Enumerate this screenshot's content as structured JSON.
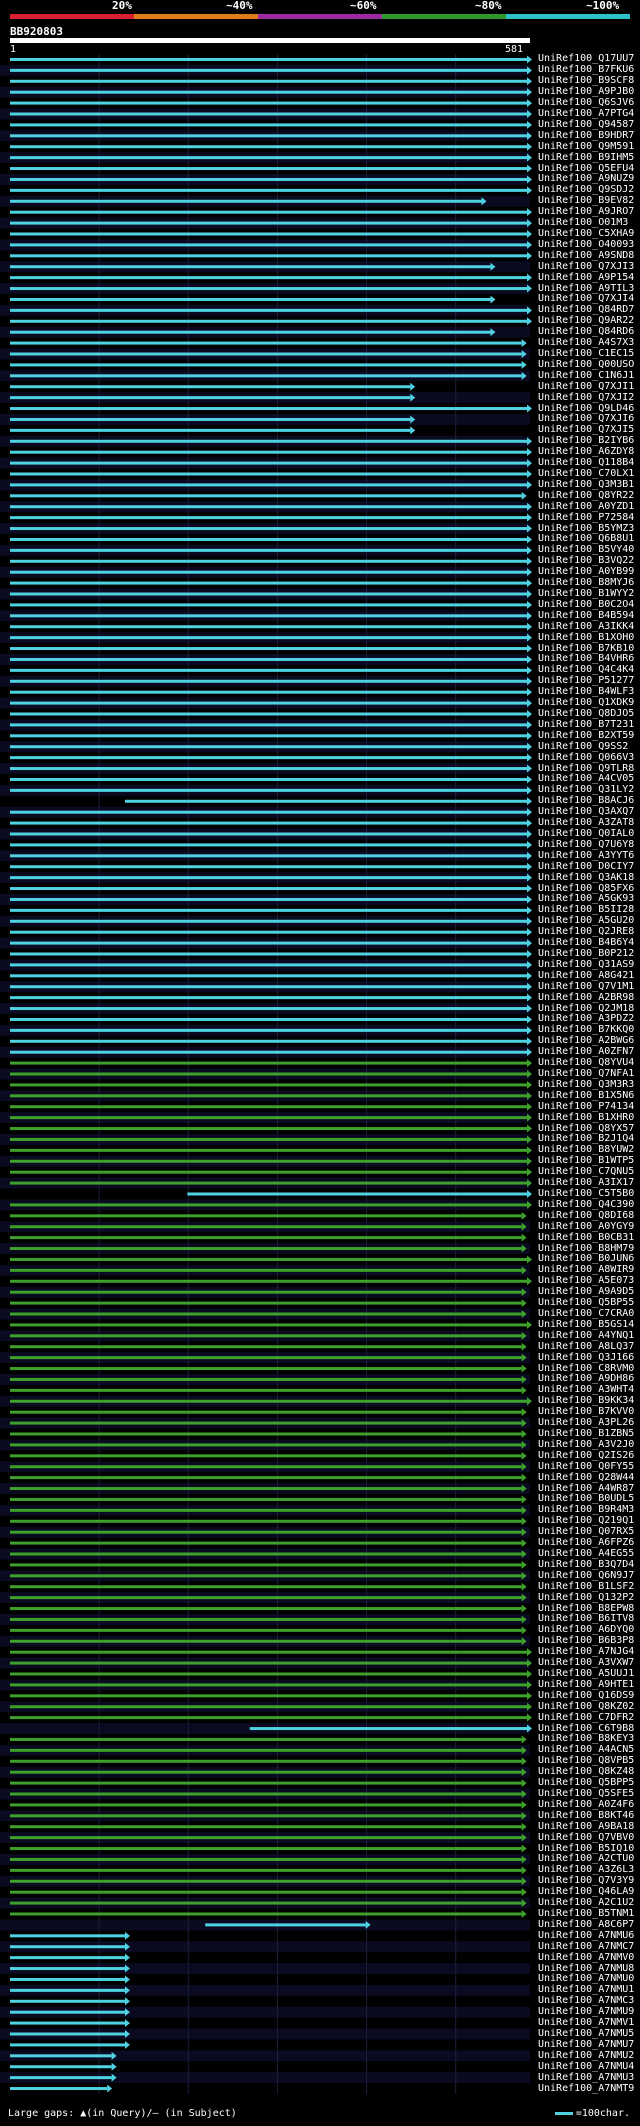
{
  "scale": {
    "labels": [
      "20%",
      "~40%",
      "~60%",
      "~80%",
      "~100%"
    ],
    "colors": [
      "#d8202e",
      "#e07b1a",
      "#9a2a9e",
      "#2e9a2e",
      "#2ec0c8"
    ]
  },
  "query": {
    "name": "BB920803",
    "start": "1",
    "end": "581"
  },
  "grid": {
    "stripe": "#0a0a20",
    "gridline": "#1e1e3a",
    "cyan": "#4fd3e3",
    "green": "#3ea12b"
  },
  "hits": [
    {
      "id": "UniRef100_Q17UU7",
      "start": 1,
      "end": 581,
      "pct": 100
    },
    {
      "id": "UniRef100_B7FKU6",
      "start": 1,
      "end": 581,
      "pct": 100
    },
    {
      "id": "UniRef100_B9SCF8",
      "start": 1,
      "end": 581,
      "pct": 100
    },
    {
      "id": "UniRef100_A9PJB0",
      "start": 1,
      "end": 581,
      "pct": 100
    },
    {
      "id": "UniRef100_Q6SJV6",
      "start": 1,
      "end": 581,
      "pct": 100
    },
    {
      "id": "UniRef100_A7PTG4",
      "start": 1,
      "end": 581,
      "pct": 100
    },
    {
      "id": "UniRef100_Q94587",
      "start": 1,
      "end": 581,
      "pct": 100
    },
    {
      "id": "UniRef100_B9HDR7",
      "start": 1,
      "end": 581,
      "pct": 100
    },
    {
      "id": "UniRef100_Q9M591",
      "start": 1,
      "end": 581,
      "pct": 100
    },
    {
      "id": "UniRef100_B9IHM5",
      "start": 1,
      "end": 581,
      "pct": 100
    },
    {
      "id": "UniRef100_Q5EFU4",
      "start": 1,
      "end": 581,
      "pct": 100
    },
    {
      "id": "UniRef100_A9NUZ9",
      "start": 1,
      "end": 581,
      "pct": 100
    },
    {
      "id": "UniRef100_Q9SDJ2",
      "start": 1,
      "end": 581,
      "pct": 100
    },
    {
      "id": "UniRef100_B9EV82",
      "start": 1,
      "end": 530,
      "pct": 100
    },
    {
      "id": "UniRef100_A9JRO7",
      "start": 1,
      "end": 581,
      "pct": 100
    },
    {
      "id": "UniRef100_O01M3",
      "start": 1,
      "end": 581,
      "pct": 100
    },
    {
      "id": "UniRef100_C5XHA9",
      "start": 1,
      "end": 581,
      "pct": 100
    },
    {
      "id": "UniRef100_O40093",
      "start": 1,
      "end": 581,
      "pct": 100
    },
    {
      "id": "UniRef100_A9SND8",
      "start": 1,
      "end": 581,
      "pct": 100
    },
    {
      "id": "UniRef100_Q7XJI3",
      "start": 1,
      "end": 540,
      "pct": 100
    },
    {
      "id": "UniRef100_A9P154",
      "start": 1,
      "end": 581,
      "pct": 100
    },
    {
      "id": "UniRef100_A9TIL3",
      "start": 1,
      "end": 581,
      "pct": 100
    },
    {
      "id": "UniRef100_Q7XJI4",
      "start": 1,
      "end": 540,
      "pct": 100
    },
    {
      "id": "UniRef100_Q84RD7",
      "start": 1,
      "end": 581,
      "pct": 100
    },
    {
      "id": "UniRef100_Q9AR22",
      "start": 1,
      "end": 581,
      "pct": 100
    },
    {
      "id": "UniRef100_Q84RD6",
      "start": 1,
      "end": 540,
      "pct": 100
    },
    {
      "id": "UniRef100_A4S7X3",
      "start": 1,
      "end": 575,
      "pct": 100
    },
    {
      "id": "UniRef100_C1EC15",
      "start": 1,
      "end": 575,
      "pct": 100
    },
    {
      "id": "UniRef100_Q00USO",
      "start": 1,
      "end": 575,
      "pct": 100
    },
    {
      "id": "UniRef100_C1N6J1",
      "start": 1,
      "end": 575,
      "pct": 100
    },
    {
      "id": "UniRef100_Q7XJI1",
      "start": 1,
      "end": 450,
      "pct": 100
    },
    {
      "id": "UniRef100_Q7XJI2",
      "start": 1,
      "end": 450,
      "pct": 100
    },
    {
      "id": "UniRef100_Q9LD46",
      "start": 1,
      "end": 581,
      "pct": 100
    },
    {
      "id": "UniRef100_Q7XJI6",
      "start": 1,
      "end": 450,
      "pct": 100
    },
    {
      "id": "UniRef100_Q7XJI5",
      "start": 1,
      "end": 450,
      "pct": 100
    },
    {
      "id": "UniRef100_B2IYB6",
      "start": 1,
      "end": 581,
      "pct": 100
    },
    {
      "id": "UniRef100_A6ZDY8",
      "start": 1,
      "end": 581,
      "pct": 100
    },
    {
      "id": "UniRef100_Q118B4",
      "start": 1,
      "end": 581,
      "pct": 100
    },
    {
      "id": "UniRef100_C70LX1",
      "start": 1,
      "end": 581,
      "pct": 100
    },
    {
      "id": "UniRef100_Q3M3B1",
      "start": 1,
      "end": 581,
      "pct": 100
    },
    {
      "id": "UniRef100_Q8YR22",
      "start": 1,
      "end": 575,
      "pct": 100
    },
    {
      "id": "UniRef100_A0YZD1",
      "start": 1,
      "end": 581,
      "pct": 100
    },
    {
      "id": "UniRef100_P72584",
      "start": 1,
      "end": 581,
      "pct": 100
    },
    {
      "id": "UniRef100_B5YMZ3",
      "start": 1,
      "end": 581,
      "pct": 100
    },
    {
      "id": "UniRef100_Q6B8U1",
      "start": 1,
      "end": 581,
      "pct": 100
    },
    {
      "id": "UniRef100_B5VY40",
      "start": 1,
      "end": 581,
      "pct": 100
    },
    {
      "id": "UniRef100_B3VQ22",
      "start": 1,
      "end": 581,
      "pct": 100
    },
    {
      "id": "UniRef100_A0YB99",
      "start": 1,
      "end": 581,
      "pct": 100
    },
    {
      "id": "UniRef100_B8MYJ6",
      "start": 1,
      "end": 581,
      "pct": 100
    },
    {
      "id": "UniRef100_B1WYY2",
      "start": 1,
      "end": 581,
      "pct": 100
    },
    {
      "id": "UniRef100_B0C2O4",
      "start": 1,
      "end": 581,
      "pct": 100
    },
    {
      "id": "UniRef100_B4B594",
      "start": 1,
      "end": 581,
      "pct": 100
    },
    {
      "id": "UniRef100_A3IKK4",
      "start": 1,
      "end": 581,
      "pct": 100
    },
    {
      "id": "UniRef100_B1XOH0",
      "start": 1,
      "end": 581,
      "pct": 100
    },
    {
      "id": "UniRef100_B7KB10",
      "start": 1,
      "end": 581,
      "pct": 100
    },
    {
      "id": "UniRef100_B4VHR6",
      "start": 1,
      "end": 581,
      "pct": 100
    },
    {
      "id": "UniRef100_Q4C4K4",
      "start": 1,
      "end": 581,
      "pct": 100
    },
    {
      "id": "UniRef100_P51277",
      "start": 1,
      "end": 581,
      "pct": 100
    },
    {
      "id": "UniRef100_B4WLF3",
      "start": 1,
      "end": 581,
      "pct": 100
    },
    {
      "id": "UniRef100_Q1XDK9",
      "start": 1,
      "end": 581,
      "pct": 100
    },
    {
      "id": "UniRef100_Q8DJO5",
      "start": 1,
      "end": 581,
      "pct": 100
    },
    {
      "id": "UniRef100_B7T231",
      "start": 1,
      "end": 581,
      "pct": 100
    },
    {
      "id": "UniRef100_B2XT59",
      "start": 1,
      "end": 581,
      "pct": 100
    },
    {
      "id": "UniRef100_Q9SS2",
      "start": 1,
      "end": 581,
      "pct": 100
    },
    {
      "id": "UniRef100_Q066V3",
      "start": 1,
      "end": 581,
      "pct": 100
    },
    {
      "id": "UniRef100_Q9TLR8",
      "start": 1,
      "end": 581,
      "pct": 100
    },
    {
      "id": "UniRef100_A4CV05",
      "start": 1,
      "end": 581,
      "pct": 100
    },
    {
      "id": "UniRef100_Q31LY2",
      "start": 1,
      "end": 581,
      "pct": 100
    },
    {
      "id": "UniRef100_B8ACJ6",
      "start": 130,
      "end": 581,
      "pct": 100
    },
    {
      "id": "UniRef100_Q3AXQ7",
      "start": 1,
      "end": 581,
      "pct": 100
    },
    {
      "id": "UniRef100_A3ZAT8",
      "start": 1,
      "end": 581,
      "pct": 100
    },
    {
      "id": "UniRef100_Q0IAL0",
      "start": 1,
      "end": 581,
      "pct": 100
    },
    {
      "id": "UniRef100_Q7U6Y8",
      "start": 1,
      "end": 581,
      "pct": 100
    },
    {
      "id": "UniRef100_A3YYT6",
      "start": 1,
      "end": 581,
      "pct": 100
    },
    {
      "id": "UniRef100_D0CIY7",
      "start": 1,
      "end": 581,
      "pct": 100
    },
    {
      "id": "UniRef100_Q3AK18",
      "start": 1,
      "end": 581,
      "pct": 100
    },
    {
      "id": "UniRef100_Q85FX6",
      "start": 1,
      "end": 581,
      "pct": 100
    },
    {
      "id": "UniRef100_A5GK93",
      "start": 1,
      "end": 581,
      "pct": 100
    },
    {
      "id": "UniRef100_B5II28",
      "start": 1,
      "end": 581,
      "pct": 100
    },
    {
      "id": "UniRef100_A5GU20",
      "start": 1,
      "end": 581,
      "pct": 100
    },
    {
      "id": "UniRef100_Q2JRE8",
      "start": 1,
      "end": 581,
      "pct": 100
    },
    {
      "id": "UniRef100_B4B6Y4",
      "start": 1,
      "end": 581,
      "pct": 100
    },
    {
      "id": "UniRef100_B0P212",
      "start": 1,
      "end": 581,
      "pct": 100
    },
    {
      "id": "UniRef100_Q31AS9",
      "start": 1,
      "end": 581,
      "pct": 100
    },
    {
      "id": "UniRef100_A8G421",
      "start": 1,
      "end": 581,
      "pct": 100
    },
    {
      "id": "UniRef100_Q7V1M1",
      "start": 1,
      "end": 581,
      "pct": 100
    },
    {
      "id": "UniRef100_A2BR98",
      "start": 1,
      "end": 581,
      "pct": 100
    },
    {
      "id": "UniRef100_Q2JM18",
      "start": 1,
      "end": 581,
      "pct": 100
    },
    {
      "id": "UniRef100_A3PDZ2",
      "start": 1,
      "end": 581,
      "pct": 100
    },
    {
      "id": "UniRef100_B7KKQ0",
      "start": 1,
      "end": 581,
      "pct": 100
    },
    {
      "id": "UniRef100_A2BWG6",
      "start": 1,
      "end": 581,
      "pct": 100
    },
    {
      "id": "UniRef100_A0ZFN7",
      "start": 1,
      "end": 581,
      "pct": 100
    },
    {
      "id": "UniRef100_Q8YVU4",
      "start": 1,
      "end": 581,
      "pct": 80
    },
    {
      "id": "UniRef100_Q7NFA1",
      "start": 1,
      "end": 581,
      "pct": 80
    },
    {
      "id": "UniRef100_Q3M3R3",
      "start": 1,
      "end": 581,
      "pct": 80
    },
    {
      "id": "UniRef100_B1X5N6",
      "start": 1,
      "end": 581,
      "pct": 80
    },
    {
      "id": "UniRef100_P74134",
      "start": 1,
      "end": 581,
      "pct": 80
    },
    {
      "id": "UniRef100_B1XHR0",
      "start": 1,
      "end": 581,
      "pct": 80
    },
    {
      "id": "UniRef100_Q8YX57",
      "start": 1,
      "end": 581,
      "pct": 80
    },
    {
      "id": "UniRef100_B2J1Q4",
      "start": 1,
      "end": 581,
      "pct": 80
    },
    {
      "id": "UniRef100_B8YUW2",
      "start": 1,
      "end": 581,
      "pct": 80
    },
    {
      "id": "UniRef100_B1WTP5",
      "start": 1,
      "end": 581,
      "pct": 80
    },
    {
      "id": "UniRef100_C7QNU5",
      "start": 1,
      "end": 581,
      "pct": 80
    },
    {
      "id": "UniRef100_A3IX17",
      "start": 1,
      "end": 581,
      "pct": 80
    },
    {
      "id": "UniRef100_C5T5B0",
      "start": 200,
      "end": 581,
      "pct": 100
    },
    {
      "id": "UniRef100_Q4C390",
      "start": 1,
      "end": 581,
      "pct": 80
    },
    {
      "id": "UniRef100_Q8DI68",
      "start": 1,
      "end": 575,
      "pct": 80
    },
    {
      "id": "UniRef100_A0YGY9",
      "start": 1,
      "end": 575,
      "pct": 80
    },
    {
      "id": "UniRef100_B0CB31",
      "start": 1,
      "end": 575,
      "pct": 80
    },
    {
      "id": "UniRef100_B8HM79",
      "start": 1,
      "end": 575,
      "pct": 80
    },
    {
      "id": "UniRef100_B0JUN6",
      "start": 1,
      "end": 581,
      "pct": 80
    },
    {
      "id": "UniRef100_A8WIR9",
      "start": 1,
      "end": 575,
      "pct": 80
    },
    {
      "id": "UniRef100_A5E073",
      "start": 1,
      "end": 581,
      "pct": 80
    },
    {
      "id": "UniRef100_A9A9D5",
      "start": 1,
      "end": 575,
      "pct": 80
    },
    {
      "id": "UniRef100_Q5BP55",
      "start": 1,
      "end": 575,
      "pct": 80
    },
    {
      "id": "UniRef100_C7CRA0",
      "start": 1,
      "end": 575,
      "pct": 80
    },
    {
      "id": "UniRef100_B5GS14",
      "start": 1,
      "end": 581,
      "pct": 80
    },
    {
      "id": "UniRef100_A4YNQ1",
      "start": 1,
      "end": 575,
      "pct": 80
    },
    {
      "id": "UniRef100_A8LQ37",
      "start": 1,
      "end": 575,
      "pct": 80
    },
    {
      "id": "UniRef100_Q3J166",
      "start": 1,
      "end": 575,
      "pct": 80
    },
    {
      "id": "UniRef100_C8RVM0",
      "start": 1,
      "end": 575,
      "pct": 80
    },
    {
      "id": "UniRef100_A9DH86",
      "start": 1,
      "end": 575,
      "pct": 80
    },
    {
      "id": "UniRef100_A3WHT4",
      "start": 1,
      "end": 575,
      "pct": 80
    },
    {
      "id": "UniRef100_B9KK34",
      "start": 1,
      "end": 581,
      "pct": 80
    },
    {
      "id": "UniRef100_B7KVV0",
      "start": 1,
      "end": 575,
      "pct": 80
    },
    {
      "id": "UniRef100_A3PL26",
      "start": 1,
      "end": 575,
      "pct": 80
    },
    {
      "id": "UniRef100_B1ZBN5",
      "start": 1,
      "end": 575,
      "pct": 80
    },
    {
      "id": "UniRef100_A3V2J0",
      "start": 1,
      "end": 575,
      "pct": 80
    },
    {
      "id": "UniRef100_Q2IS26",
      "start": 1,
      "end": 575,
      "pct": 80
    },
    {
      "id": "UniRef100_Q0FY55",
      "start": 1,
      "end": 575,
      "pct": 80
    },
    {
      "id": "UniRef100_Q28W44",
      "start": 1,
      "end": 575,
      "pct": 80
    },
    {
      "id": "UniRef100_A4WR87",
      "start": 1,
      "end": 575,
      "pct": 80
    },
    {
      "id": "UniRef100_B0UDL5",
      "start": 1,
      "end": 575,
      "pct": 80
    },
    {
      "id": "UniRef100_B9R4M3",
      "start": 1,
      "end": 575,
      "pct": 80
    },
    {
      "id": "UniRef100_Q219Q1",
      "start": 1,
      "end": 575,
      "pct": 80
    },
    {
      "id": "UniRef100_Q07RX5",
      "start": 1,
      "end": 575,
      "pct": 80
    },
    {
      "id": "UniRef100_A6FPZ6",
      "start": 1,
      "end": 575,
      "pct": 80
    },
    {
      "id": "UniRef100_A4EG55",
      "start": 1,
      "end": 575,
      "pct": 80
    },
    {
      "id": "UniRef100_B3Q7D4",
      "start": 1,
      "end": 575,
      "pct": 80
    },
    {
      "id": "UniRef100_Q6N9J7",
      "start": 1,
      "end": 575,
      "pct": 80
    },
    {
      "id": "UniRef100_B1LSF2",
      "start": 1,
      "end": 575,
      "pct": 80
    },
    {
      "id": "UniRef100_Q132P2",
      "start": 1,
      "end": 575,
      "pct": 80
    },
    {
      "id": "UniRef100_B8EPW8",
      "start": 1,
      "end": 575,
      "pct": 80
    },
    {
      "id": "UniRef100_B6ITV8",
      "start": 1,
      "end": 575,
      "pct": 80
    },
    {
      "id": "UniRef100_A6DYQ0",
      "start": 1,
      "end": 575,
      "pct": 80
    },
    {
      "id": "UniRef100_B6B3P8",
      "start": 1,
      "end": 575,
      "pct": 80
    },
    {
      "id": "UniRef100_A7NJG4",
      "start": 1,
      "end": 581,
      "pct": 80
    },
    {
      "id": "UniRef100_A3VXW7",
      "start": 1,
      "end": 581,
      "pct": 80
    },
    {
      "id": "UniRef100_A5UUJ1",
      "start": 1,
      "end": 581,
      "pct": 80
    },
    {
      "id": "UniRef100_A9HTE1",
      "start": 1,
      "end": 581,
      "pct": 80
    },
    {
      "id": "UniRef100_Q16DS9",
      "start": 1,
      "end": 581,
      "pct": 80
    },
    {
      "id": "UniRef100_Q8KZ02",
      "start": 1,
      "end": 581,
      "pct": 80
    },
    {
      "id": "UniRef100_C7DFR2",
      "start": 1,
      "end": 581,
      "pct": 80
    },
    {
      "id": "UniRef100_C6T9B8",
      "start": 270,
      "end": 581,
      "pct": 100
    },
    {
      "id": "UniRef100_B8KEY3",
      "start": 1,
      "end": 575,
      "pct": 80
    },
    {
      "id": "UniRef100_A4ACN5",
      "start": 1,
      "end": 575,
      "pct": 80
    },
    {
      "id": "UniRef100_Q8VPB5",
      "start": 1,
      "end": 575,
      "pct": 80
    },
    {
      "id": "UniRef100_Q8KZ48",
      "start": 1,
      "end": 575,
      "pct": 80
    },
    {
      "id": "UniRef100_Q5BPP5",
      "start": 1,
      "end": 575,
      "pct": 80
    },
    {
      "id": "UniRef100_Q5SFE5",
      "start": 1,
      "end": 575,
      "pct": 80
    },
    {
      "id": "UniRef100_A0Z4F6",
      "start": 1,
      "end": 575,
      "pct": 80
    },
    {
      "id": "UniRef100_B8KT46",
      "start": 1,
      "end": 575,
      "pct": 80
    },
    {
      "id": "UniRef100_A9BA18",
      "start": 1,
      "end": 575,
      "pct": 80
    },
    {
      "id": "UniRef100_Q7VBV0",
      "start": 1,
      "end": 575,
      "pct": 80
    },
    {
      "id": "UniRef100_B5IQ10",
      "start": 1,
      "end": 575,
      "pct": 80
    },
    {
      "id": "UniRef100_A2CTU0",
      "start": 1,
      "end": 575,
      "pct": 80
    },
    {
      "id": "UniRef100_A3Z6L3",
      "start": 1,
      "end": 575,
      "pct": 80
    },
    {
      "id": "UniRef100_Q7V3Y9",
      "start": 1,
      "end": 575,
      "pct": 80
    },
    {
      "id": "UniRef100_Q46LA9",
      "start": 1,
      "end": 575,
      "pct": 80
    },
    {
      "id": "UniRef100_A2C1U2",
      "start": 1,
      "end": 575,
      "pct": 80
    },
    {
      "id": "UniRef100_B5TNM1",
      "start": 1,
      "end": 575,
      "pct": 80
    },
    {
      "id": "UniRef100_A8C6P7",
      "start": 220,
      "end": 400,
      "pct": 100
    },
    {
      "id": "UniRef100_A7NMU6",
      "start": 1,
      "end": 130,
      "pct": 100
    },
    {
      "id": "UniRef100_A7NMC7",
      "start": 1,
      "end": 130,
      "pct": 100
    },
    {
      "id": "UniRef100_A7NMV0",
      "start": 1,
      "end": 130,
      "pct": 100
    },
    {
      "id": "UniRef100_A7NMU8",
      "start": 1,
      "end": 130,
      "pct": 100
    },
    {
      "id": "UniRef100_A7NMU0",
      "start": 1,
      "end": 130,
      "pct": 100
    },
    {
      "id": "UniRef100_A7NMU1",
      "start": 1,
      "end": 130,
      "pct": 100
    },
    {
      "id": "UniRef100_A7NMC3",
      "start": 1,
      "end": 130,
      "pct": 100
    },
    {
      "id": "UniRef100_A7NMU9",
      "start": 1,
      "end": 130,
      "pct": 100
    },
    {
      "id": "UniRef100_A7NMV1",
      "start": 1,
      "end": 130,
      "pct": 100
    },
    {
      "id": "UniRef100_A7NMU5",
      "start": 1,
      "end": 130,
      "pct": 100
    },
    {
      "id": "UniRef100_A7NMU7",
      "start": 1,
      "end": 130,
      "pct": 100
    },
    {
      "id": "UniRef100_A7NMU2",
      "start": 1,
      "end": 115,
      "pct": 100
    },
    {
      "id": "UniRef100_A7NMU4",
      "start": 1,
      "end": 115,
      "pct": 100
    },
    {
      "id": "UniRef100_A7NMU3",
      "start": 1,
      "end": 115,
      "pct": 100
    },
    {
      "id": "UniRef100_A7NMT9",
      "start": 1,
      "end": 110,
      "pct": 100
    }
  ],
  "footer": {
    "text": "Large gaps: ▲(in Query)/– (in Subject)"
  },
  "legend": {
    "text": "=100char."
  }
}
